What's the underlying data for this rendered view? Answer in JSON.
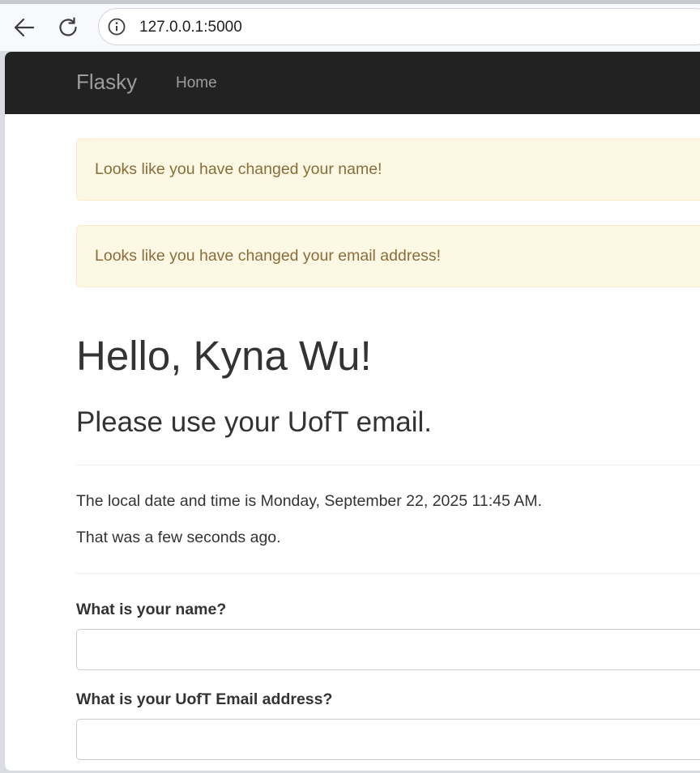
{
  "browser": {
    "url": "127.0.0.1:5000",
    "icons": [
      "back-arrow-icon",
      "reload-icon",
      "info-icon"
    ]
  },
  "navbar": {
    "brand": "Flasky",
    "home": "Home",
    "colors": {
      "background": "#222222",
      "text": "#9d9d9d"
    }
  },
  "flashes": [
    {
      "message": "Looks like you have changed your name!"
    },
    {
      "message": "Looks like you have changed your email address!"
    }
  ],
  "main": {
    "greeting": "Hello, Kyna Wu!",
    "subheading": "Please use your UofT email.",
    "datetime_text": "The local date and time is Monday, September 22, 2025 11:45 AM.",
    "relative_text": "That was a few seconds ago."
  },
  "form": {
    "name_label": "What is your name?",
    "name_value": "",
    "email_label": "What is your UofT Email address?",
    "email_value": ""
  },
  "colors": {
    "flash_background": "#fcf8e3",
    "flash_border": "#faebcc",
    "flash_text": "#8a6d3b",
    "body_text": "#333333"
  }
}
